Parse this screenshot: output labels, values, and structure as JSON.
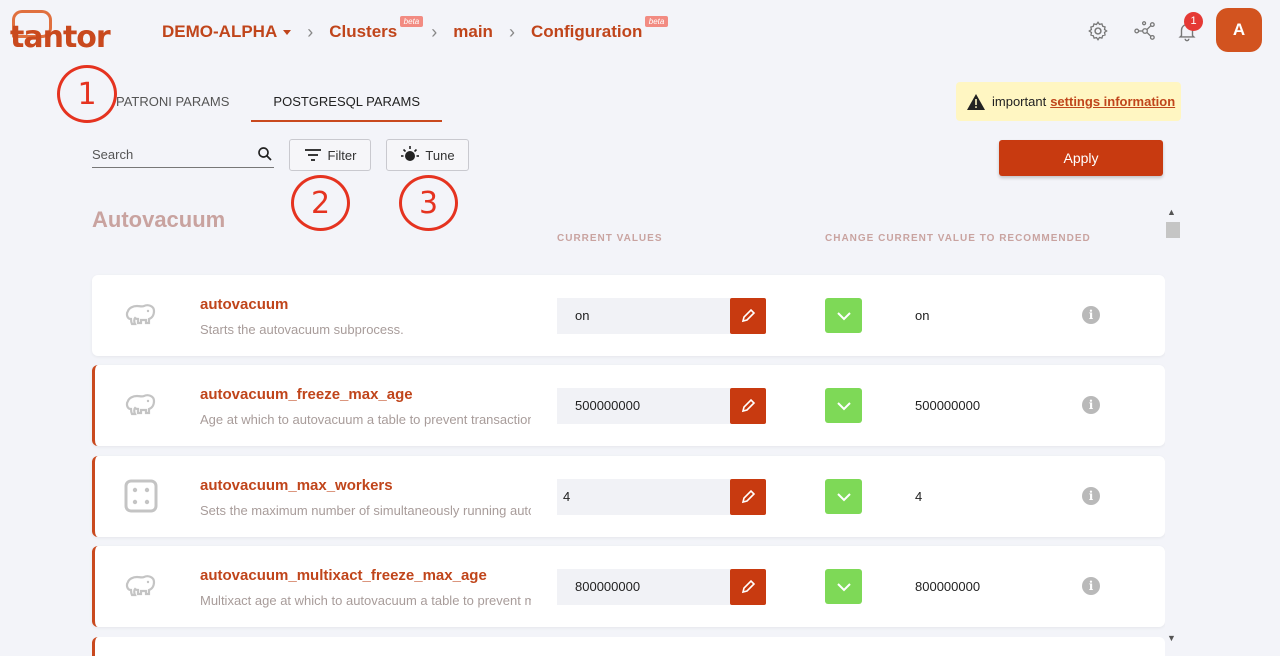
{
  "header": {
    "logo_text": "tantor",
    "breadcrumb": {
      "project": "DEMO-ALPHA",
      "clusters": "Clusters",
      "clusters_badge": "beta",
      "cluster": "main",
      "configuration": "Configuration",
      "configuration_badge": "beta"
    },
    "icons": [
      "gear-icon",
      "network-icon",
      "bell-icon"
    ],
    "notification_count": "1",
    "avatar_initial": "A"
  },
  "tabs": [
    {
      "label": "PATRONI PARAMS",
      "active": false
    },
    {
      "label": "POSTGRESQL PARAMS",
      "active": true
    }
  ],
  "annotations": [
    "1",
    "2",
    "3"
  ],
  "notice": {
    "prefix": "important",
    "link": "settings information"
  },
  "toolbar": {
    "search_placeholder": "Search",
    "filter_label": "Filter",
    "tune_label": "Tune",
    "apply_label": "Apply"
  },
  "section": {
    "title": "Autovacuum",
    "col_current": "CURRENT VALUES",
    "col_recommended": "CHANGE CURRENT VALUE TO RECOMMENDED"
  },
  "params": [
    {
      "name": "autovacuum",
      "desc": "Starts the autovacuum subprocess.",
      "value": "on",
      "recommended": "on",
      "icon": "elephant-icon",
      "modified": false
    },
    {
      "name": "autovacuum_freeze_max_age",
      "desc": "Age at which to autovacuum a table to prevent transaction ID wraparound.",
      "value": "500000000",
      "recommended": "500000000",
      "icon": "elephant-icon",
      "modified": true
    },
    {
      "name": "autovacuum_max_workers",
      "desc": "Sets the maximum number of simultaneously running autovacuum worker processes.",
      "value": "4",
      "recommended": "4",
      "icon": "server-icon",
      "modified": true
    },
    {
      "name": "autovacuum_multixact_freeze_max_age",
      "desc": "Multixact age at which to autovacuum a table to prevent multixact wraparound.",
      "value": "800000000",
      "recommended": "800000000",
      "icon": "elephant-icon",
      "modified": true
    }
  ],
  "colors": {
    "accent": "#c9491e",
    "apply": "#c83a10",
    "check": "#7ed957",
    "notice_bg": "#fff6c2"
  }
}
